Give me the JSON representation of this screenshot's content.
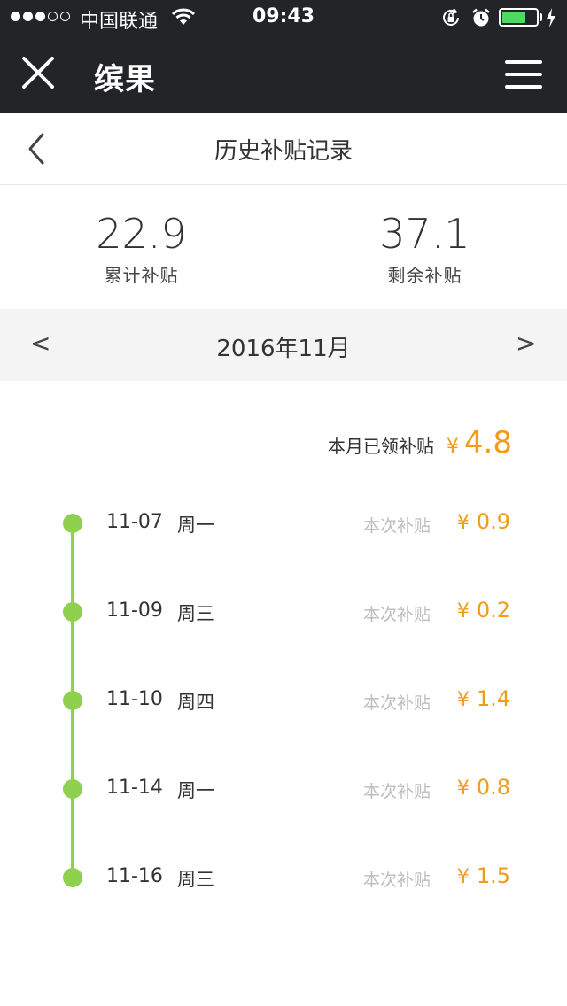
{
  "status_bar": {
    "carrier": "中国联通",
    "time": "09:43"
  },
  "title_bar": {
    "title": "缤果"
  },
  "page": {
    "title": "历史补贴记录"
  },
  "stats": {
    "total_value": "22.9",
    "total_label": "累计补贴",
    "remaining_value": "37.1",
    "remaining_label": "剩余补贴"
  },
  "month_switcher": {
    "prev_label": "<",
    "month": "2016年11月",
    "next_label": ">"
  },
  "month_total": {
    "label": "本月已领补贴",
    "currency": "¥",
    "amount": "4.8"
  },
  "records": [
    {
      "date": "11-07",
      "weekday": "周一",
      "label": "本次补贴",
      "currency": "¥",
      "amount": "0.9"
    },
    {
      "date": "11-09",
      "weekday": "周三",
      "label": "本次补贴",
      "currency": "¥",
      "amount": "0.2"
    },
    {
      "date": "11-10",
      "weekday": "周四",
      "label": "本次补贴",
      "currency": "¥",
      "amount": "1.4"
    },
    {
      "date": "11-14",
      "weekday": "周一",
      "label": "本次补贴",
      "currency": "¥",
      "amount": "0.8"
    },
    {
      "date": "11-16",
      "weekday": "周三",
      "label": "本次补贴",
      "currency": "¥",
      "amount": "1.5"
    }
  ],
  "colors": {
    "accent": "#f39a1b",
    "timeline": "#8fd14f",
    "header_bg": "#222427"
  }
}
